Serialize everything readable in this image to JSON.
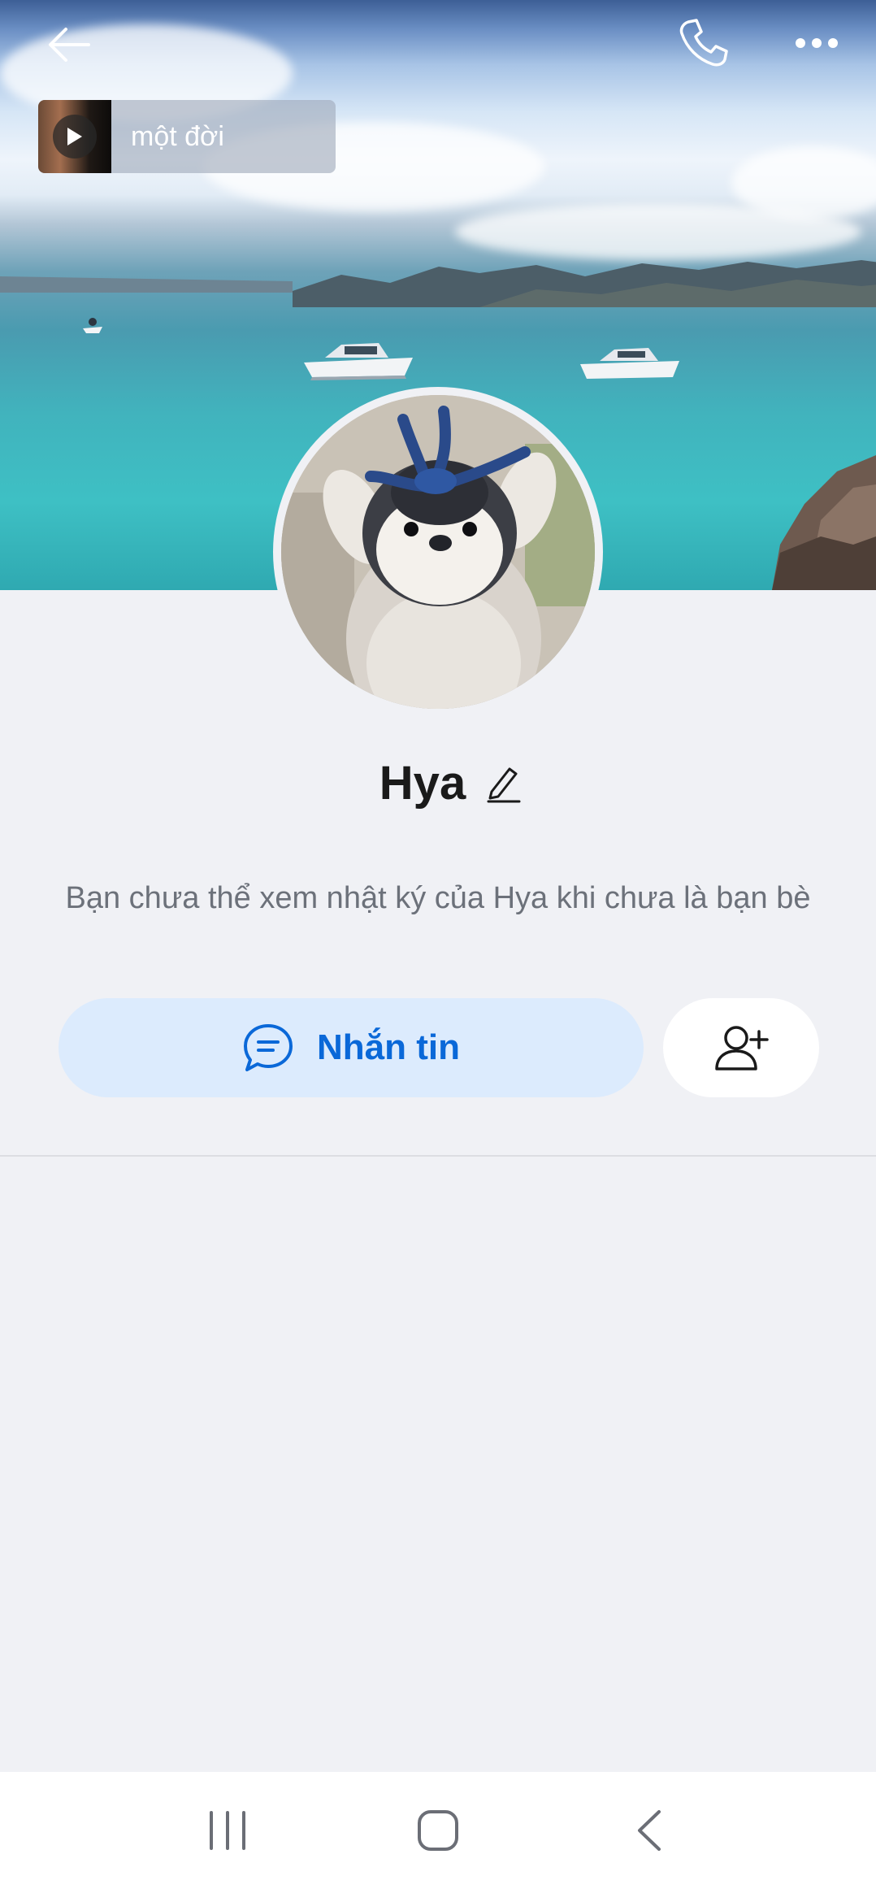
{
  "header": {
    "back_icon": "arrow-left-icon",
    "call_icon": "phone-icon",
    "more_icon": "more-dots-icon"
  },
  "music": {
    "title": "một đời",
    "play_icon": "play-icon"
  },
  "profile": {
    "name": "Hya",
    "edit_icon": "pencil-icon",
    "notice": "Bạn chưa thể xem nhật ký của Hya khi chưa là bạn bè"
  },
  "actions": {
    "message_label": "Nhắn tin",
    "message_icon": "chat-bubble-icon",
    "add_friend_icon": "add-user-icon"
  },
  "system_nav": {
    "recents_icon": "recents-icon",
    "home_icon": "home-icon",
    "back_icon": "back-chevron-icon"
  },
  "colors": {
    "accent": "#0a68d8",
    "message_button_bg": "#dcebfd",
    "page_bg": "#f0f1f5"
  }
}
